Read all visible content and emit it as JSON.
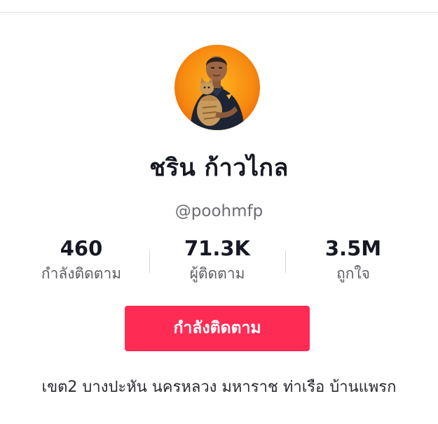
{
  "profile": {
    "display_name": "ชริน ก้าวไกล",
    "username": "@poohmfp",
    "avatar_icon": "profile-photo",
    "bio": "เขต2 บางปะหัน นครหลวง มหาราช ท่าเรือ บ้านแพรก"
  },
  "stats": {
    "following": {
      "value": "460",
      "label": "กำลังติดตาม"
    },
    "followers": {
      "value": "71.3K",
      "label": "ผู้ติดตาม"
    },
    "likes": {
      "value": "3.5M",
      "label": "ถูกใจ"
    }
  },
  "actions": {
    "follow_label": "กำลังติดตาม"
  },
  "colors": {
    "accent": "#fe2c55",
    "text_primary": "#161823",
    "text_secondary": "#6b6c73",
    "avatar_bg": "#f28a1a"
  }
}
